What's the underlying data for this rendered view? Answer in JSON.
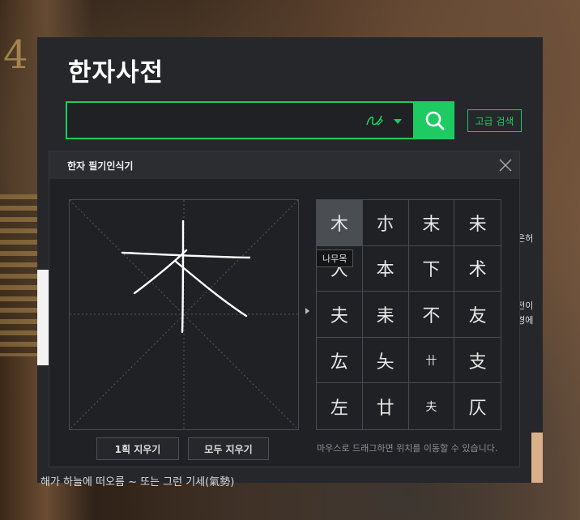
{
  "background": {
    "number": "4"
  },
  "page": {
    "title": "한자사전",
    "search": {
      "value": "",
      "placeholder": ""
    },
    "advanced_search_label": "고급 검색",
    "below_text": "해가 하늘에 떠오름 ~ 또는 그런 기세(氣勢)",
    "right_peek": [
      "작은허",
      "사전이",
      "환경에"
    ]
  },
  "handwriting": {
    "title": "한자 필기인식기",
    "candidates": [
      "木",
      "朩",
      "末",
      "未",
      "大",
      "本",
      "下",
      "术",
      "夫",
      "耒",
      "不",
      "友",
      "厷",
      "夨",
      "卄",
      "支",
      "左",
      "廿",
      "夫",
      "仄"
    ],
    "selected_index": 0,
    "tooltip": "나무목",
    "clear_one_label": "1획 지우기",
    "clear_all_label": "모두 지우기",
    "hint": "마우스로 드래그하면 위치를 이동할 수 있습니다."
  },
  "colors": {
    "accent": "#1ecb62",
    "panel": "#25272b",
    "popup": "#1f2124"
  },
  "icons": [
    "handwriting-icon",
    "search-icon",
    "close-icon",
    "dropdown-arrow-icon"
  ]
}
